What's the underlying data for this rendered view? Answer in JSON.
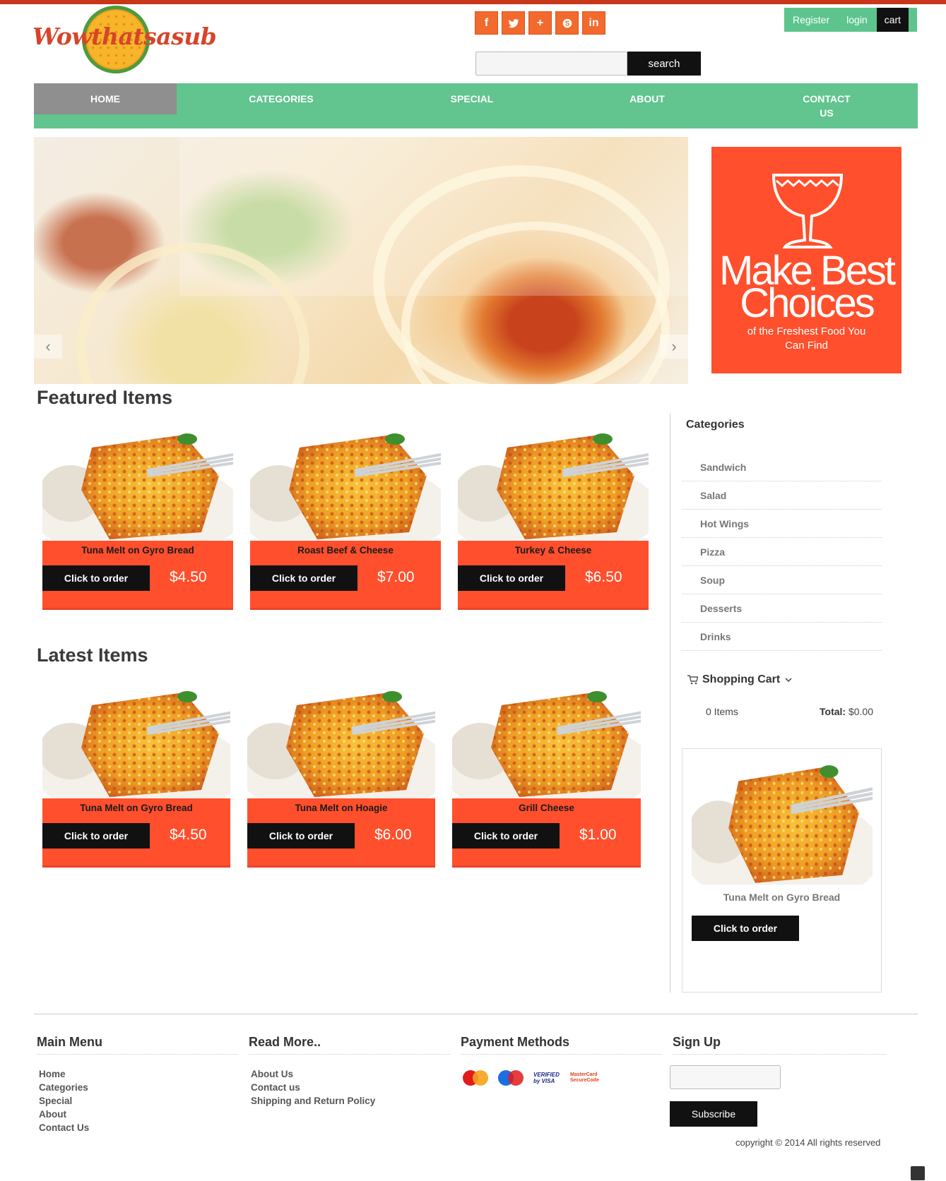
{
  "brand": {
    "logo_text": "Wowthatsasub"
  },
  "social": [
    {
      "icon": "facebook-icon",
      "glyph": "f"
    },
    {
      "icon": "twitter-icon",
      "glyph": ""
    },
    {
      "icon": "google-plus-icon",
      "glyph": "+"
    },
    {
      "icon": "skype-icon",
      "glyph": ""
    },
    {
      "icon": "linkedin-icon",
      "glyph": "in"
    }
  ],
  "account": {
    "register": "Register",
    "login": "login",
    "cart": "cart"
  },
  "search": {
    "placeholder": "",
    "button": "search"
  },
  "nav": {
    "home": "HOME",
    "categories": "CATEGORIES",
    "special": "SPECIAL",
    "about": "ABOUT",
    "contact_line1": "CONTACT",
    "contact_line2": "US"
  },
  "slider": {
    "prev": "‹",
    "next": "›"
  },
  "promo": {
    "title_line1": "Make Best",
    "title_line2": "Choices",
    "subtitle": "of the Freshest Food You Can Find"
  },
  "featured": {
    "title": "Featured Items",
    "items": [
      {
        "name": "Tuna Melt on Gyro Bread",
        "price": "$4.50",
        "button": "Click to order"
      },
      {
        "name": "Roast Beef & Cheese",
        "price": "$7.00",
        "button": "Click to order"
      },
      {
        "name": "Turkey & Cheese",
        "price": "$6.50",
        "button": "Click to order"
      }
    ]
  },
  "latest": {
    "title": "Latest Items",
    "items": [
      {
        "name": "Tuna Melt on Gyro Bread",
        "price": "$4.50",
        "button": "Click to order"
      },
      {
        "name": "Tuna Melt on Hoagie",
        "price": "$6.00",
        "button": "Click to order"
      },
      {
        "name": "Grill Cheese",
        "price": "$1.00",
        "button": "Click to order"
      }
    ]
  },
  "sidebar": {
    "categories_title": "Categories",
    "categories": [
      "Sandwich",
      "Salad",
      "Hot Wings",
      "Pizza",
      "Soup",
      "Desserts",
      "Drinks"
    ],
    "cart_title": "Shopping Cart",
    "cart_items": "0 Items",
    "total_label": "Total:",
    "total_value": "$0.00",
    "card": {
      "name": "Tuna Melt on Gyro Bread",
      "button": "Click to order"
    }
  },
  "footer": {
    "main_menu": {
      "title": "Main Menu",
      "links": [
        "Home",
        "Categories",
        "Special",
        "About",
        "Contact Us"
      ]
    },
    "read_more": {
      "title": "Read More..",
      "links": [
        "About Us",
        "Contact us",
        "Shipping and Return Policy"
      ]
    },
    "payment": {
      "title": "Payment Methods",
      "methods": [
        "MasterCard",
        "Maestro",
        "Verified by VISA",
        "MasterCard SecureCode"
      ]
    },
    "signup": {
      "title": "Sign Up",
      "placeholder": "",
      "button": "Subscribe"
    },
    "copyright": "copyright © 2014 All rights reserved"
  },
  "colors": {
    "accent_green": "#62c48f",
    "accent_orange": "#ff4f2c",
    "dark": "#111111"
  }
}
